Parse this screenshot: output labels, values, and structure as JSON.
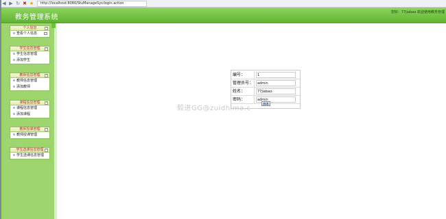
{
  "browser": {
    "address": "http://localhost:8080/StuManageSys/login.action"
  },
  "header": {
    "title": "教务管理系统",
    "welcome": "您好：77jiabao 欢迎使用教务管理"
  },
  "sidebar": {
    "panels": [
      {
        "title": "个人信息",
        "items": [
          "查看个人信息"
        ]
      },
      {
        "title": "学生信息管理",
        "items": [
          "学生信息管理",
          "添加学生"
        ]
      },
      {
        "title": "教师信息管理",
        "items": [
          "教师信息管理",
          "添加教师"
        ]
      },
      {
        "title": "课程信息管理",
        "items": [
          "课程信息管理",
          "添加课程"
        ]
      },
      {
        "title": "教师授课管理",
        "items": [
          "教师授课管理"
        ]
      },
      {
        "title": "学生选课信息管理",
        "items": [
          "学生选课信息管理"
        ]
      }
    ]
  },
  "form": {
    "rows": [
      {
        "label": "编号：",
        "value": "1"
      },
      {
        "label": "管理员号：",
        "value": "admin"
      },
      {
        "label": "姓名：",
        "value": "77jiabao"
      },
      {
        "label": "密码：",
        "value": "admin"
      }
    ],
    "submit_label": "修改"
  },
  "watermark": "毅进GG@zuidhima.c"
}
